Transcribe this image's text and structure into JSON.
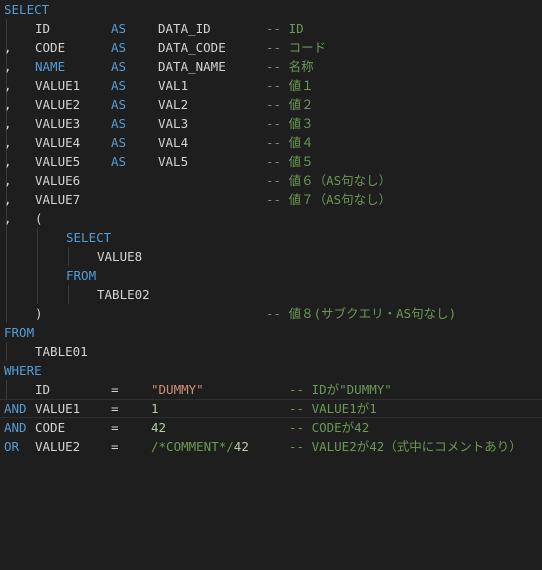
{
  "code": {
    "l1": [
      "SELECT"
    ],
    "l2": [
      "ID",
      "AS",
      "DATA_ID",
      "-- ID"
    ],
    "l3": [
      ",",
      "CODE",
      "AS",
      "DATA_CODE",
      "-- コード"
    ],
    "l4": [
      ",",
      "NAME",
      "AS",
      "DATA_NAME",
      "-- 名称"
    ],
    "l5": [
      ",",
      "VALUE1",
      "AS",
      "VAL1",
      "-- 値１"
    ],
    "l6": [
      ",",
      "VALUE2",
      "AS",
      "VAL2",
      "-- 値２"
    ],
    "l7": [
      ",",
      "VALUE3",
      "AS",
      "VAL3",
      "-- 値３"
    ],
    "l8": [
      ",",
      "VALUE4",
      "AS",
      "VAL4",
      "-- 値４"
    ],
    "l9": [
      ",",
      "VALUE5",
      "AS",
      "VAL5",
      "-- 値５"
    ],
    "l10": [
      ",",
      "VALUE6",
      "-- 値６（AS句なし）"
    ],
    "l11": [
      ",",
      "VALUE7",
      "-- 値７（AS句なし）"
    ],
    "l12": [
      ",",
      "("
    ],
    "l13": [
      "SELECT"
    ],
    "l14": [
      "VALUE8"
    ],
    "l15": [
      "FROM"
    ],
    "l16": [
      "TABLE02"
    ],
    "l17": [
      ")",
      "-- 値８(サブクエリ・AS句なし)"
    ],
    "l18": [
      "FROM"
    ],
    "l19": [
      "TABLE01"
    ],
    "l20": [
      "WHERE"
    ],
    "l21": [
      "ID",
      "=",
      "\"DUMMY\"",
      "-- IDが\"DUMMY\""
    ],
    "l22": [
      "AND",
      "VALUE1",
      "=",
      "1",
      "-- VALUE1が1"
    ],
    "l23": [
      "AND",
      "CODE",
      "=",
      "42",
      "-- CODEが42"
    ],
    "l24": [
      "OR",
      "VALUE2",
      "=",
      "/*COMMENT*/42",
      "-- VALUE2が42（式中にコメントあり）"
    ]
  },
  "colors": {
    "background": "#1e1e1e",
    "keyword": "#569cd6",
    "identifier": "#d4d4d4",
    "comment": "#6a9955",
    "string": "#ce9178",
    "number": "#b5cea8"
  }
}
